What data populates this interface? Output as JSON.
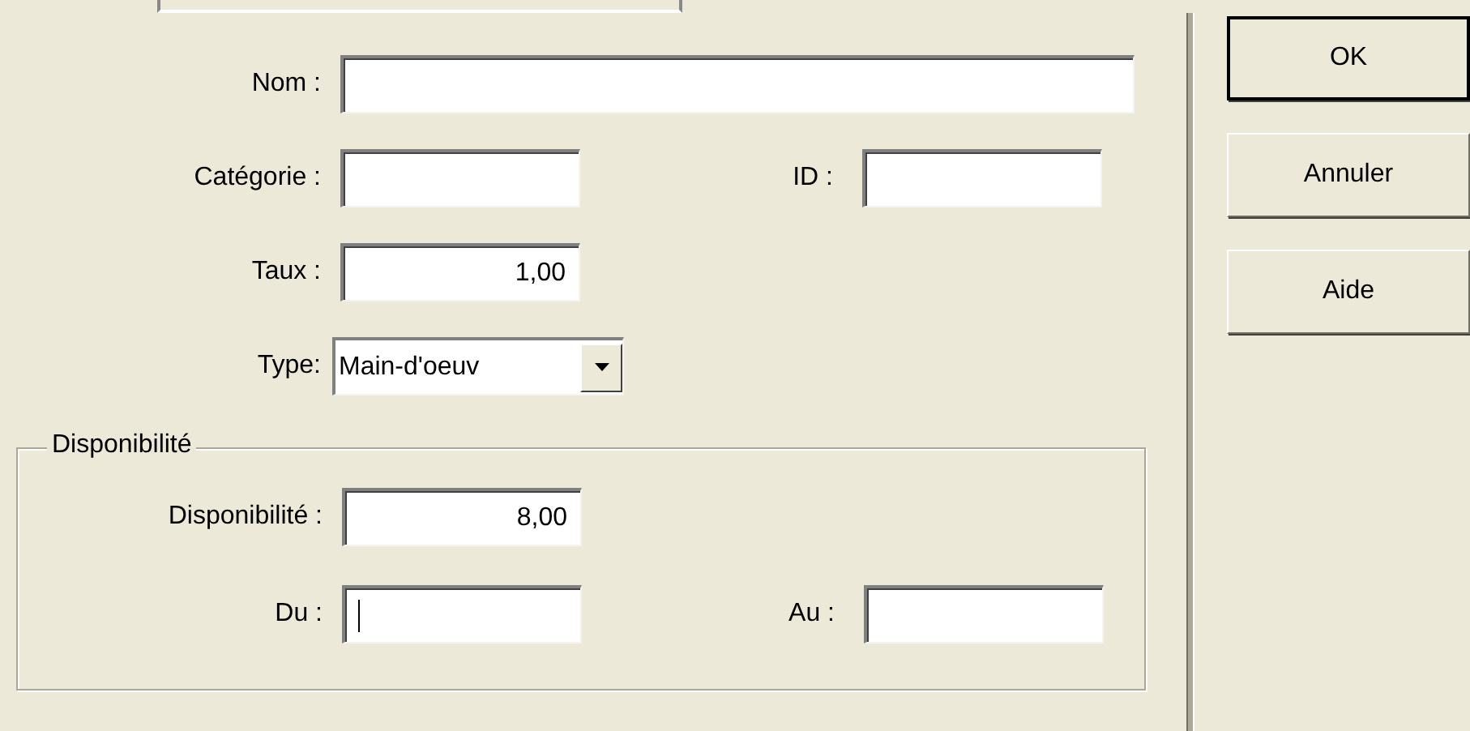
{
  "fields": [
    {
      "label": "Nom :",
      "focused": false
    },
    {
      "label": "Catégorie :",
      "focused": false,
      "side": {
        "label": "ID :",
        "focused": false
      }
    },
    {
      "label": "Taux :",
      "value": "1,00",
      "focused": false
    },
    {
      "label": "Type:",
      "kind": "dropdown",
      "value": "Main-d'oeuv"
    }
  ],
  "group": {
    "title": "Disponibilité",
    "fields": [
      {
        "label": "Disponibilité :",
        "value": "8,00",
        "focused": false
      },
      {
        "label": "Du :",
        "focused": true,
        "side": {
          "label": "Au :",
          "focused": false
        }
      }
    ]
  },
  "buttons": [
    {
      "label": "OK",
      "default": true
    },
    {
      "label": "Annuler",
      "default": false
    },
    {
      "label": "Aide",
      "default": false
    }
  ]
}
